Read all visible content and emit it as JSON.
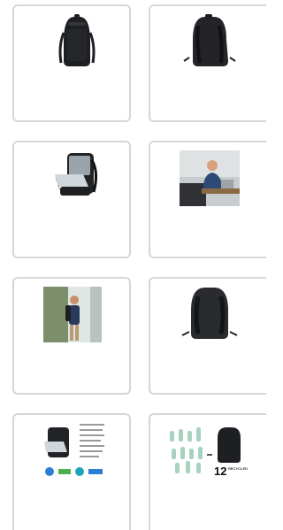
{
  "gallery": {
    "items": [
      {
        "name": "backpack-front-view",
        "icon": "backpack-front-image"
      },
      {
        "name": "backpack-back-view",
        "icon": "backpack-back-image"
      },
      {
        "name": "backpack-open-laptop-compartment",
        "icon": "backpack-open-image"
      },
      {
        "name": "man-with-laptop-photo",
        "icon": "lifestyle-office-image"
      },
      {
        "name": "man-wearing-backpack-photo",
        "icon": "lifestyle-outdoor-image"
      },
      {
        "name": "backpack-rear-straps-view",
        "icon": "backpack-rear-image"
      },
      {
        "name": "backpack-features-infographic",
        "icon": "infographic-image"
      },
      {
        "name": "recycled-bottles-infographic",
        "icon": "recycled-bottles-image"
      }
    ],
    "recycled_number": "12",
    "recycled_caption": "RECYCLED",
    "colors": {
      "border": "#d6d6d6",
      "bag": "#1e1f22",
      "accent": "#2a7fd4"
    }
  }
}
